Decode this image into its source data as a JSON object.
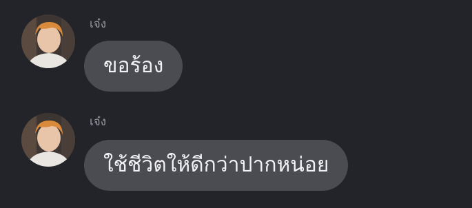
{
  "messages": [
    {
      "sender": "เจ๋ง",
      "text": "ขอร้อง",
      "avatar_icon": "profile-photo-icon"
    },
    {
      "sender": "เจ๋ง",
      "text": "ใช้ชีวิตให้ดีกว่าปากหน่อย",
      "avatar_icon": "profile-photo-icon"
    }
  ],
  "colors": {
    "background": "#232429",
    "bubble": "#4b4c52",
    "text": "#f2f2f4",
    "sender": "#9a9ba2"
  }
}
